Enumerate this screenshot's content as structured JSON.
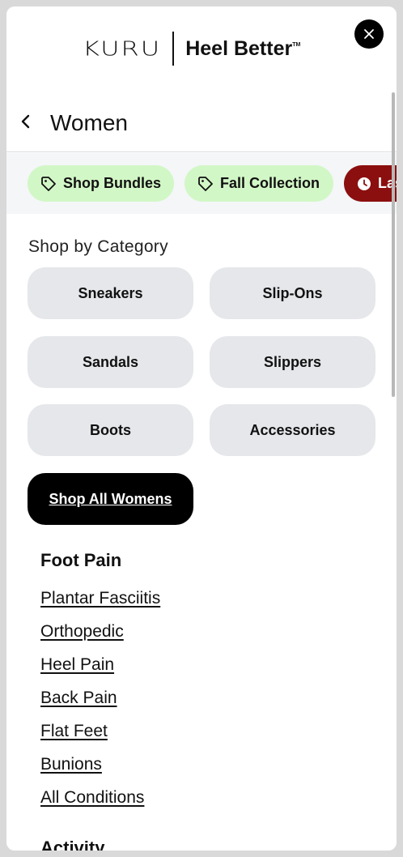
{
  "header": {
    "logo_brand": "KURU",
    "logo_tagline": "Heel Better",
    "logo_tm": "TM"
  },
  "title_row": {
    "title": "Women"
  },
  "promos": [
    {
      "label": "Shop Bundles",
      "icon": "tag-icon",
      "color": "#d2f7c6"
    },
    {
      "label": "Fall Collection",
      "icon": "tag-icon",
      "color": "#d2f7c6"
    },
    {
      "label": "Last",
      "icon": "clock-icon",
      "color": "#8b0f0f"
    }
  ],
  "categories": {
    "heading": "Shop by Category",
    "items": [
      "Sneakers",
      "Slip-Ons",
      "Sandals",
      "Slippers",
      "Boots",
      "Accessories"
    ],
    "shop_all": "Shop All Womens"
  },
  "foot_pain": {
    "heading": "Foot Pain",
    "links": [
      "Plantar Fasciitis",
      "Orthopedic",
      "Heel Pain",
      "Back Pain",
      "Flat Feet",
      "Bunions",
      "All Conditions"
    ]
  },
  "activity": {
    "heading": "Activity"
  },
  "colors": {
    "accent_green": "#d2f7c6",
    "accent_red": "#8b0f0f",
    "button_gray": "#e5e7ea"
  }
}
